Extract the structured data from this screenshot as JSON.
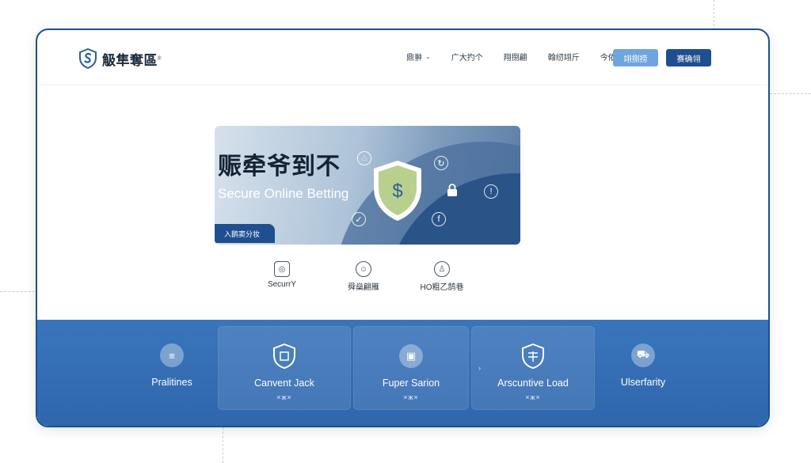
{
  "brand": {
    "name": "觙隼奪區",
    "mark": "®"
  },
  "nav": {
    "items": [
      {
        "label": "鼎翀",
        "has_dropdown": true
      },
      {
        "label": "广大扚个",
        "has_dropdown": false
      },
      {
        "label": "翔捌翩",
        "has_dropdown": false
      },
      {
        "label": "翰纫翊斤",
        "has_dropdown": false
      },
      {
        "label": "今侬纫韧",
        "has_dropdown": false
      }
    ],
    "button_light": "翊捌捞",
    "button_dark": "赛确翎"
  },
  "hero": {
    "title": "赈牵爷到不",
    "subtitle": "Secure Online Betting",
    "tag": "入鹅窦分妆",
    "shield_symbol": "$",
    "icons": [
      "user-icon",
      "document-icon",
      "lock-icon",
      "alert-icon",
      "check-icon",
      "info-icon"
    ]
  },
  "features": [
    {
      "label": "SecurrY",
      "icon": "camera-icon"
    },
    {
      "label": "舜燊翩雁",
      "icon": "face-icon"
    },
    {
      "label": "HO粗乙鹄巷",
      "icon": "users-icon"
    }
  ],
  "cards": [
    {
      "title": "Pralitines",
      "sub": "",
      "icon": "list-icon"
    },
    {
      "title": "Canvent Jack",
      "sub": "×ж×",
      "icon": "shield-icon"
    },
    {
      "title": "Fuper Sarion",
      "sub": "×ж×",
      "icon": "badge-icon"
    },
    {
      "title": "Arscuntive Load",
      "sub": "×ж×",
      "icon": "shield-icon"
    },
    {
      "title": "Ulserfarity",
      "sub": "",
      "icon": "cart-icon"
    }
  ],
  "colors": {
    "primary": "#1e4f8f",
    "accent": "#6fa5de",
    "strip": "#3470b5"
  }
}
